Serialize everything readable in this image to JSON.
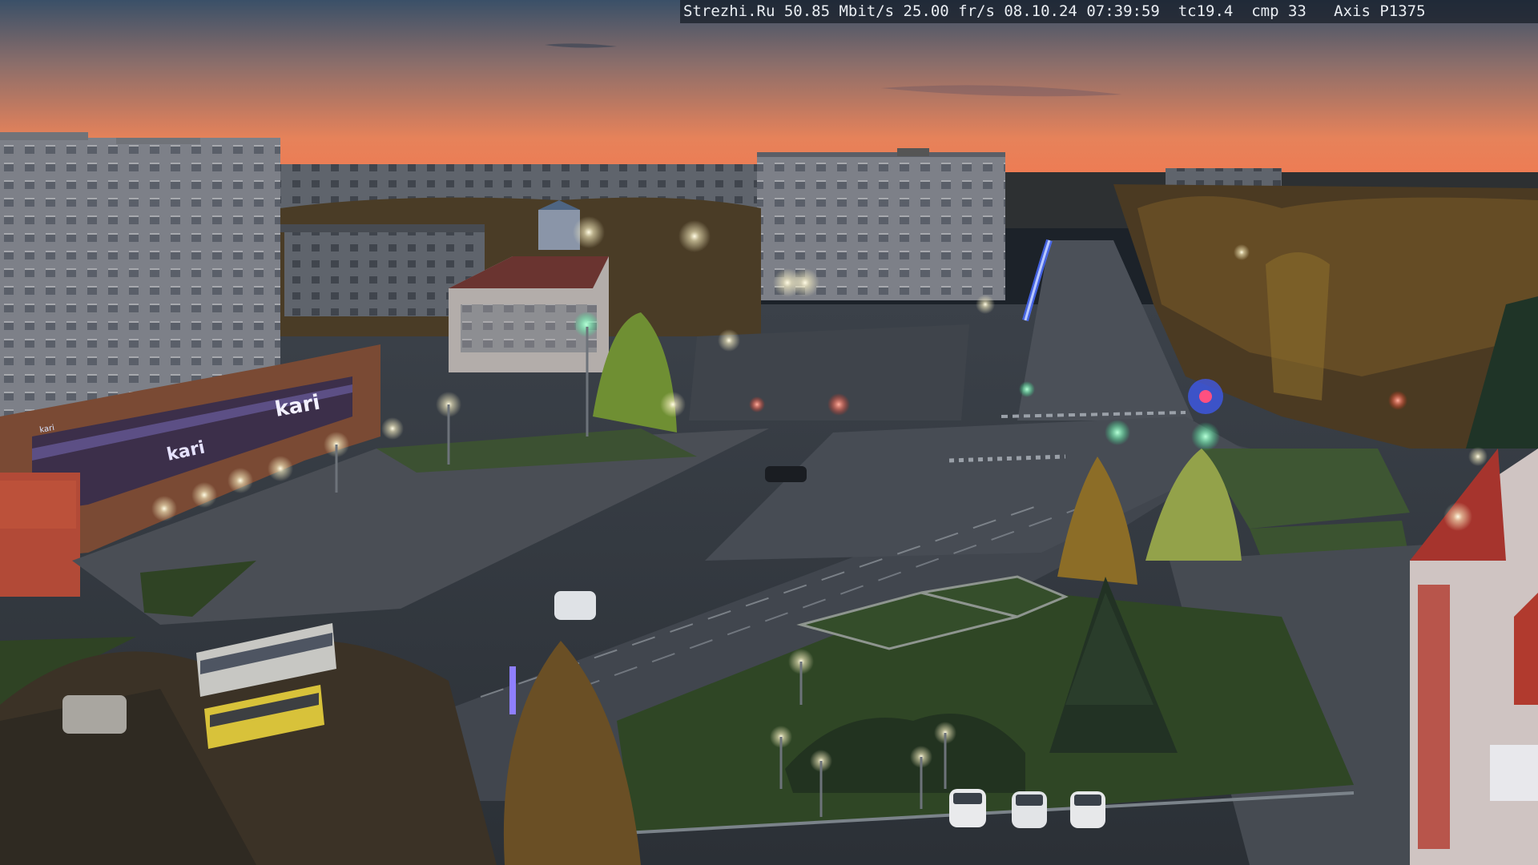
{
  "camera_overlay": {
    "text": "Strezhi.Ru 50.85 Mbit/s 25.00 fr/s 08.10.24 07:39:59  tc19.4  cmp 33   Axis P1375"
  },
  "scene": {
    "description_tags": [
      "dawn-sky",
      "apartment-blocks",
      "boulevard",
      "intersection",
      "autumn-trees",
      "street-lights",
      "parked-cars",
      "buses"
    ],
    "sky_colors": [
      "#3a5068",
      "#8c6e6a",
      "#e6825a",
      "#f07a52"
    ],
    "signage": {
      "store_sign_1": "kari",
      "store_sign_2": "kari",
      "store_sign_3": "kari"
    }
  }
}
